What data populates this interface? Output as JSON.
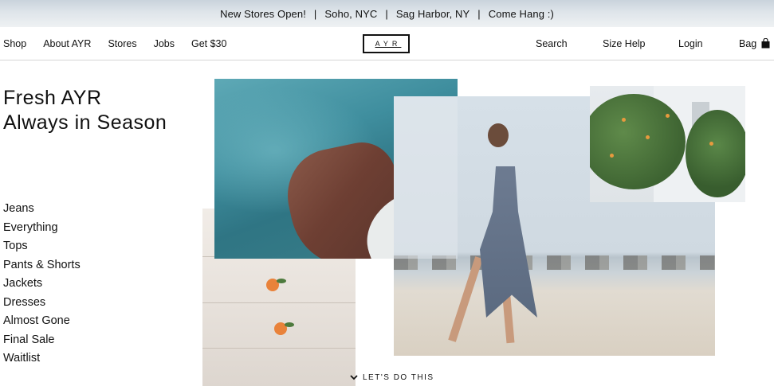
{
  "announcement": {
    "segments": [
      "New Stores Open!",
      "Soho, NYC",
      "Sag Harbor, NY",
      "Come Hang :)"
    ],
    "separator": "|"
  },
  "nav": {
    "left_links": [
      "Shop",
      "About AYR",
      "Stores",
      "Jobs",
      "Get $30"
    ],
    "logo": "AYR",
    "search_label": "Search",
    "size_help_label": "Size Help",
    "login_label": "Login",
    "bag_label": "Bag",
    "bag_icon": "shopping-bag-icon"
  },
  "hero": {
    "title_line1": "Fresh AYR",
    "title_line2": "Always in Season"
  },
  "categories": [
    "Jeans",
    "Everything",
    "Tops",
    "Pants & Shorts",
    "Jackets",
    "Dresses",
    "Almost Gone",
    "Final Sale",
    "Waitlist"
  ],
  "cta": {
    "label": "LET'S DO THIS",
    "icon": "chevron-down-icon"
  },
  "images": [
    "sea-rock-photo",
    "white-stairs-oranges-photo",
    "beach-model-photo",
    "orange-trees-building-photo"
  ],
  "colors": {
    "text": "#111111",
    "divider": "#d6d6d6",
    "announcement_bg": "#dfe5ea"
  }
}
